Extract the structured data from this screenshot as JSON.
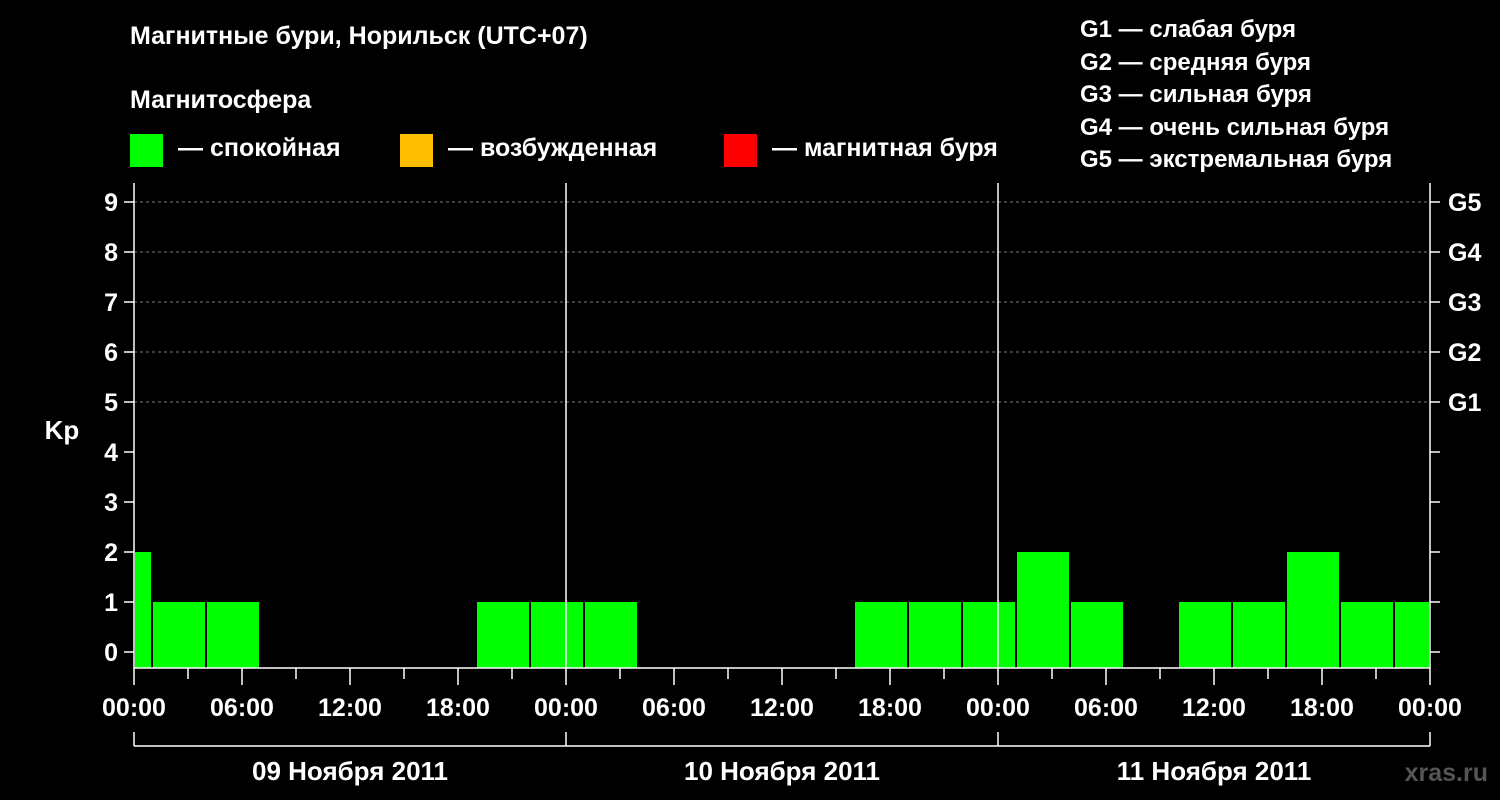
{
  "chart_data": {
    "type": "bar",
    "title": "Магнитные бури, Норильск (UTC+07)",
    "subtitle": "Магнитосфера",
    "ylabel": "Kp",
    "ylim": [
      0,
      9
    ],
    "yticks": [
      "0",
      "1",
      "2",
      "3",
      "4",
      "5",
      "6",
      "7",
      "8",
      "9"
    ],
    "right_axis": [
      {
        "level": 5,
        "label": "G1"
      },
      {
        "level": 6,
        "label": "G2"
      },
      {
        "level": 7,
        "label": "G3"
      },
      {
        "level": 8,
        "label": "G4"
      },
      {
        "level": 9,
        "label": "G5"
      }
    ],
    "xticks": [
      "00:00",
      "06:00",
      "12:00",
      "18:00",
      "00:00",
      "06:00",
      "12:00",
      "18:00",
      "00:00",
      "06:00",
      "12:00",
      "18:00",
      "00:00"
    ],
    "days": [
      "09 Ноября 2011",
      "10 Ноября 2011",
      "11 Ноября 2011"
    ],
    "grid": "dashed horizontal",
    "series": [
      {
        "values": [
          {
            "start_hour": 0,
            "end_hour": 1,
            "kp": 2
          },
          {
            "start_hour": 1,
            "end_hour": 4,
            "kp": 1
          },
          {
            "start_hour": 4,
            "end_hour": 7,
            "kp": 1
          },
          {
            "start_hour": 7,
            "end_hour": 10,
            "kp": 0
          },
          {
            "start_hour": 10,
            "end_hour": 13,
            "kp": 0
          },
          {
            "start_hour": 13,
            "end_hour": 16,
            "kp": 0
          },
          {
            "start_hour": 16,
            "end_hour": 19,
            "kp": 0
          },
          {
            "start_hour": 19,
            "end_hour": 22,
            "kp": 1
          },
          {
            "start_hour": 22,
            "end_hour": 25,
            "kp": 1
          },
          {
            "start_hour": 25,
            "end_hour": 28,
            "kp": 1
          },
          {
            "start_hour": 28,
            "end_hour": 31,
            "kp": 0
          },
          {
            "start_hour": 31,
            "end_hour": 34,
            "kp": 0
          },
          {
            "start_hour": 34,
            "end_hour": 37,
            "kp": 0
          },
          {
            "start_hour": 37,
            "end_hour": 40,
            "kp": 0
          },
          {
            "start_hour": 40,
            "end_hour": 43,
            "kp": 1
          },
          {
            "start_hour": 43,
            "end_hour": 46,
            "kp": 1
          },
          {
            "start_hour": 46,
            "end_hour": 49,
            "kp": 1
          },
          {
            "start_hour": 49,
            "end_hour": 52,
            "kp": 2
          },
          {
            "start_hour": 52,
            "end_hour": 55,
            "kp": 1
          },
          {
            "start_hour": 55,
            "end_hour": 58,
            "kp": 0
          },
          {
            "start_hour": 58,
            "end_hour": 61,
            "kp": 1
          },
          {
            "start_hour": 61,
            "end_hour": 64,
            "kp": 1
          },
          {
            "start_hour": 64,
            "end_hour": 67,
            "kp": 2
          },
          {
            "start_hour": 67,
            "end_hour": 70,
            "kp": 1
          },
          {
            "start_hour": 70,
            "end_hour": 72,
            "kp": 1
          }
        ]
      }
    ]
  },
  "legend": {
    "calm": {
      "label": "— спокойная",
      "color": "#00ff00"
    },
    "excited": {
      "label": "— возбужденная",
      "color": "#ffbf00"
    },
    "storm": {
      "label": "— магнитная буря",
      "color": "#ff0000"
    }
  },
  "g_scale": [
    "G1 — слабая буря",
    "G2 — средняя буря",
    "G3 — сильная буря",
    "G4 — очень сильная буря",
    "G5 — экстремальная буря"
  ],
  "site": "xras.ru"
}
